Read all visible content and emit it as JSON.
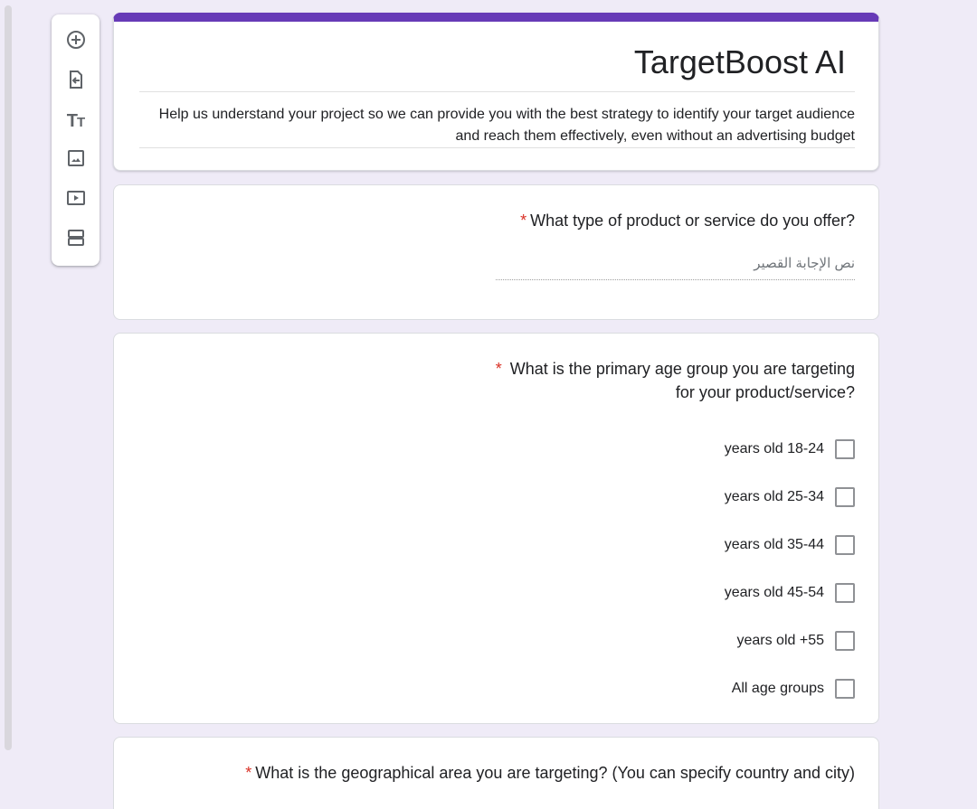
{
  "toolbar": {
    "items": [
      {
        "name": "add-question",
        "icon": "add-circle-icon"
      },
      {
        "name": "import-questions",
        "icon": "import-icon"
      },
      {
        "name": "add-title",
        "icon": "title-text-icon",
        "glyph": "Tт"
      },
      {
        "name": "add-image",
        "icon": "image-icon"
      },
      {
        "name": "add-video",
        "icon": "video-icon"
      },
      {
        "name": "add-section",
        "icon": "section-icon"
      }
    ]
  },
  "header": {
    "accent_color": "#673ab7",
    "title": "TargetBoost AI",
    "description": "Help us understand your project so we can provide you with the best strategy to identify your target audience and reach them effectively, even without an advertising budget"
  },
  "questions": [
    {
      "required_mark": "*",
      "text": "What type of product or service do you offer?",
      "placeholder": "نص الإجابة القصير"
    },
    {
      "required_mark": "*",
      "text": "What is the primary age group you are targeting for your product/service?",
      "options": [
        "years old 18-24",
        "years old 25-34",
        "years old 35-44",
        "years old 45-54",
        "years old +55",
        "All age groups"
      ]
    },
    {
      "required_mark": "*",
      "text": "What is the geographical area you are targeting? (You  can specify country and city)"
    }
  ]
}
